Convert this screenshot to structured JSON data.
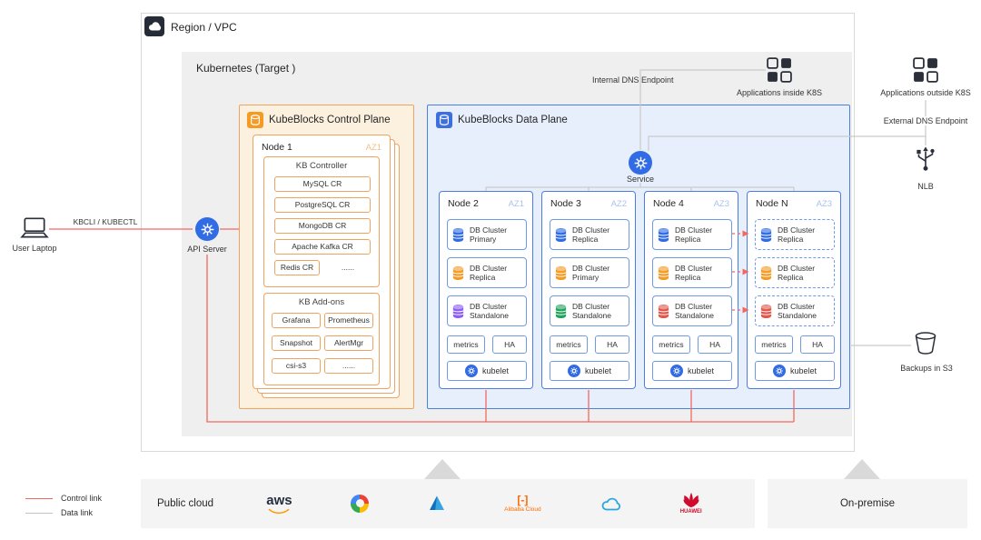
{
  "region": {
    "label": "Region / VPC"
  },
  "kubernetes": {
    "label": "Kubernetes (Target )"
  },
  "left_side": {
    "laptop_label": "User Laptop",
    "cli_label": "KBCLI / KUBECTL",
    "api_server_label": "API Server"
  },
  "endpoints": {
    "internal_dns": "Internal DNS Endpoint",
    "apps_inside": "Applications inside K8S",
    "apps_outside": "Applications outside K8S",
    "external_dns": "External DNS Endpoint",
    "nlb": "NLB",
    "backups_s3": "Backups in S3"
  },
  "control_plane": {
    "title": "KubeBlocks Control Plane",
    "node": {
      "name": "Node 1",
      "az": "AZ1",
      "controller": {
        "title": "KB Controller",
        "items": [
          "MySQL CR",
          "PostgreSQL CR",
          "MongoDB CR",
          "Apache Kafka CR"
        ],
        "redis": "Redis CR",
        "more": "......"
      },
      "addons": {
        "title": "KB Add-ons",
        "items": [
          "Grafana",
          "Prometheus",
          "Snapshot",
          "AlertMgr",
          "csi-s3",
          "......"
        ]
      }
    }
  },
  "data_plane": {
    "title": "KubeBlocks Data Plane",
    "service_label": "Service",
    "metrics_label": "metrics",
    "ha_label": "HA",
    "kubelet_label": "kubelet",
    "nodes": [
      {
        "name": "Node 2",
        "az": "AZ1",
        "clusters": [
          {
            "line1": "DB Cluster",
            "line2": "Primary",
            "color": "#2e6be5"
          },
          {
            "line1": "DB Cluster",
            "line2": "Replica",
            "color": "#f59a23"
          },
          {
            "line1": "DB Cluster",
            "line2": "Standalone",
            "color": "#8b5cf6"
          }
        ]
      },
      {
        "name": "Node 3",
        "az": "AZ2",
        "clusters": [
          {
            "line1": "DB Cluster",
            "line2": "Replica",
            "color": "#2e6be5"
          },
          {
            "line1": "DB Cluster",
            "line2": "Primary",
            "color": "#f59a23"
          },
          {
            "line1": "DB Cluster",
            "line2": "Standalone",
            "color": "#22a35c"
          }
        ]
      },
      {
        "name": "Node 4",
        "az": "AZ3",
        "clusters": [
          {
            "line1": "DB Cluster",
            "line2": "Replica",
            "color": "#2e6be5"
          },
          {
            "line1": "DB Cluster",
            "line2": "Replica",
            "color": "#f59a23"
          },
          {
            "line1": "DB Cluster",
            "line2": "Standalone",
            "color": "#e2574c"
          }
        ]
      },
      {
        "name": "Node N",
        "az": "AZ3",
        "clusters": [
          {
            "line1": "DB Cluster",
            "line2": "Replica",
            "color": "#2e6be5"
          },
          {
            "line1": "DB Cluster",
            "line2": "Replica",
            "color": "#f59a23"
          },
          {
            "line1": "DB Cluster",
            "line2": "Standalone",
            "color": "#e2574c"
          }
        ]
      }
    ]
  },
  "legend": {
    "control": "Control link",
    "data": "Data link"
  },
  "bottom": {
    "public_cloud_label": "Public cloud",
    "on_premise_label": "On-premise",
    "providers": [
      {
        "name": "AWS",
        "label": "aws"
      },
      {
        "name": "Google Cloud",
        "label": ""
      },
      {
        "name": "Microsoft Azure",
        "label": ""
      },
      {
        "name": "Alibaba Cloud",
        "mark": "[-]",
        "label": "Alibaba Cloud"
      },
      {
        "name": "Tencent Cloud",
        "label": ""
      },
      {
        "name": "Huawei",
        "label": "HUAWEI"
      }
    ]
  },
  "colors": {
    "control_link": "#f26860",
    "data_link": "#c9c9c9",
    "control_plane_accent": "#f59a23",
    "data_plane_accent": "#4a7fe0",
    "k8s_blue": "#326ce5"
  }
}
